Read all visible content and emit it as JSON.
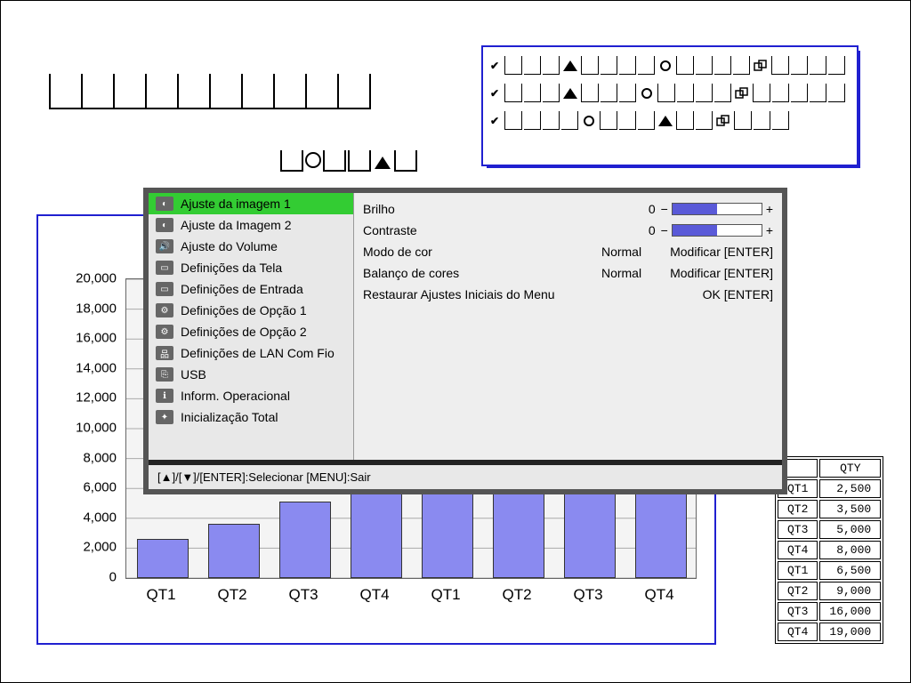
{
  "chart_data": {
    "type": "bar",
    "categories": [
      "QT1",
      "QT2",
      "QT3",
      "QT4",
      "QT1",
      "QT2",
      "QT3",
      "QT4"
    ],
    "values": [
      2500,
      3500,
      5000,
      8000,
      6500,
      9000,
      16000,
      19000
    ],
    "title": "",
    "xlabel": "",
    "ylabel": "",
    "ylim": [
      0,
      20000
    ],
    "yticks": [
      0,
      2000,
      4000,
      6000,
      8000,
      10000,
      12000,
      14000,
      16000,
      18000,
      20000
    ],
    "ytick_labels": [
      "0",
      "2,000",
      "4,000",
      "6,000",
      "8,000",
      "10,000",
      "12,000",
      "14,000",
      "16,000",
      "18,000",
      "20,000"
    ]
  },
  "table": {
    "header": "QTY",
    "rows": [
      {
        "q": "QT1",
        "v": "2,500"
      },
      {
        "q": "QT2",
        "v": "3,500"
      },
      {
        "q": "QT3",
        "v": "5,000"
      },
      {
        "q": "QT4",
        "v": "8,000"
      },
      {
        "q": "QT1",
        "v": "6,500"
      },
      {
        "q": "QT2",
        "v": "9,000"
      },
      {
        "q": "QT3",
        "v": "16,000"
      },
      {
        "q": "QT4",
        "v": "19,000"
      }
    ]
  },
  "osd": {
    "side": [
      "Ajuste da imagem 1",
      "Ajuste da Imagem 2",
      "Ajuste do Volume",
      "Definições da Tela",
      "Definições de Entrada",
      "Definições de Opção 1",
      "Definições de Opção 2",
      "Definições de LAN Com Fio",
      "USB",
      "Inform. Operacional",
      "Inicialização Total"
    ],
    "props": {
      "brilho": {
        "label": "Brilho",
        "value": "0"
      },
      "contraste": {
        "label": "Contraste",
        "value": "0"
      },
      "modo_cor": {
        "label": "Modo de cor",
        "value": "Normal",
        "action": "Modificar [ENTER]"
      },
      "balanco": {
        "label": "Balanço de cores",
        "value": "Normal",
        "action": "Modificar [ENTER]"
      },
      "restaurar": {
        "label": "Restaurar Ajustes Iniciais do Menu",
        "action": "OK [ENTER]"
      }
    },
    "footer": "[▲]/[▼]/[ENTER]:Selecionar  [MENU]:Sair"
  },
  "icons": {
    "minus": "−",
    "plus": "+"
  },
  "check": "✔"
}
